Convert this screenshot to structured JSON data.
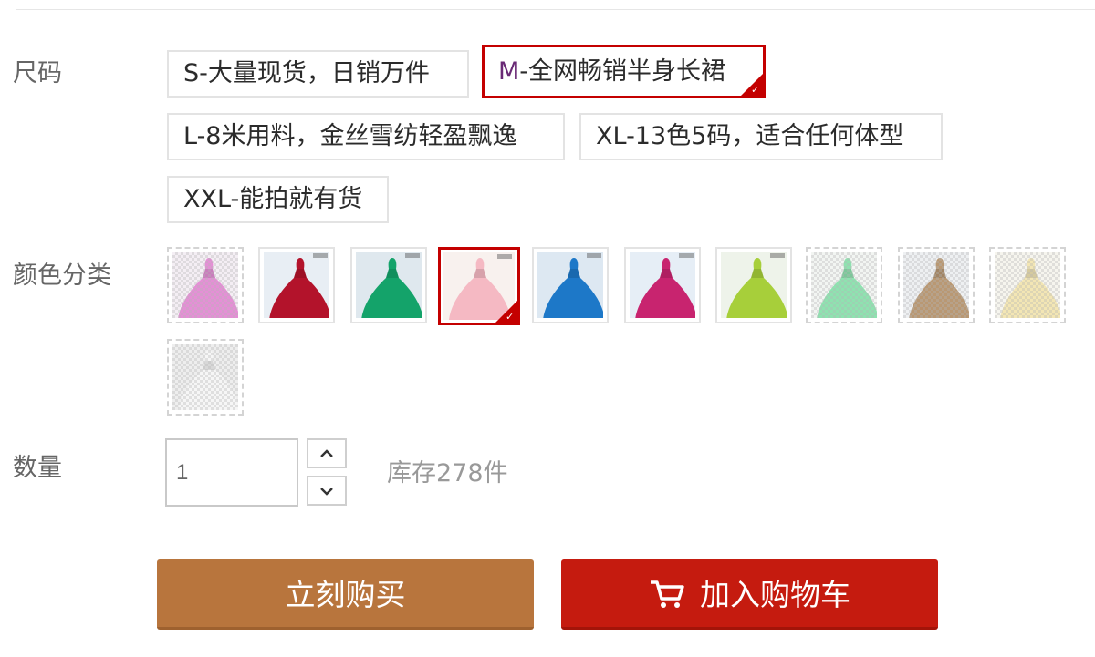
{
  "size": {
    "label": "尺码",
    "options": [
      {
        "text": "S-大量现货，日销万件",
        "selected": false
      },
      {
        "text_prefix": "M",
        "text_rest": "-全网畅销半身长裙",
        "selected": true
      },
      {
        "text": "L-8米用料，金丝雪纺轻盈飘逸",
        "selected": false
      },
      {
        "text": "XL-13色5码，适合任何体型",
        "selected": false
      },
      {
        "text": "XXL-能拍就有货",
        "selected": false
      }
    ]
  },
  "color": {
    "label": "颜色分类",
    "swatches": [
      {
        "color": "#e58fd6",
        "bg": "#f4eef4",
        "available": false
      },
      {
        "color": "#b3132b",
        "bg": "#e8eef4",
        "available": true
      },
      {
        "color": "#14a36a",
        "bg": "#dfe8ee",
        "available": true
      },
      {
        "color": "#f5b9c3",
        "bg": "#f8f1ee",
        "available": true,
        "selected": true
      },
      {
        "color": "#1d78c8",
        "bg": "#dde8f2",
        "available": true
      },
      {
        "color": "#c8246f",
        "bg": "#e6eef6",
        "available": true
      },
      {
        "color": "#a7cf3a",
        "bg": "#eef3ea",
        "available": true
      },
      {
        "color": "#8ee3b0",
        "bg": "#f2f5f2",
        "available": false
      },
      {
        "color": "#b99873",
        "bg": "#eef0f2",
        "available": false
      },
      {
        "color": "#f3e6b4",
        "bg": "#f6f5ee",
        "available": false
      },
      {
        "color": "#f6f6f6",
        "bg": "#eeeeee",
        "available": false
      }
    ]
  },
  "quantity": {
    "label": "数量",
    "value": "1",
    "stock": "库存278件"
  },
  "actions": {
    "buy_now": "立刻购买",
    "add_to_cart": "加入购物车"
  },
  "colors": {
    "selected_border": "#c40000",
    "buy_button": "#b8753d",
    "cart_button": "#c51b0f"
  }
}
